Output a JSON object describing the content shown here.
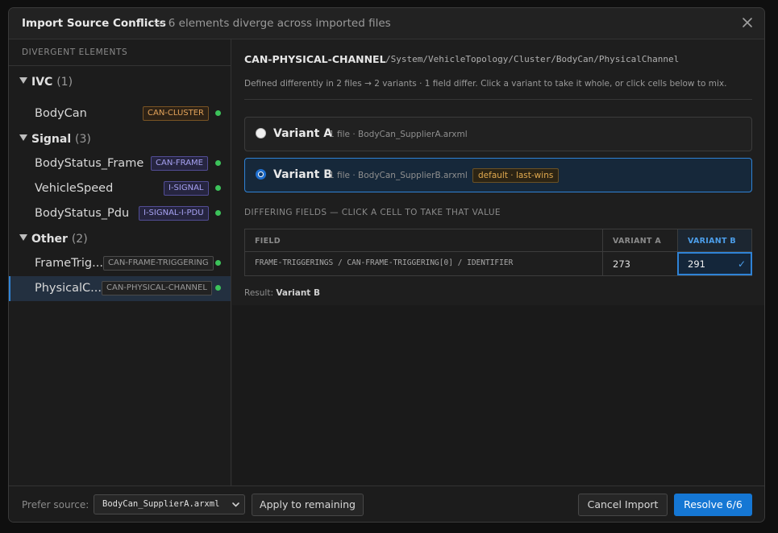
{
  "header": {
    "title": "Import Source Conflicts",
    "subtitle": "— 6 elements diverge across imported files"
  },
  "sidebar": {
    "section_title": "DIVERGENT ELEMENTS",
    "groups": [
      {
        "name": "IVC",
        "count": "(1)"
      },
      {
        "name": "Signal",
        "count": "(3)"
      },
      {
        "name": "Other",
        "count": "(2)"
      }
    ],
    "items": [
      {
        "name": "BodyCan",
        "badge": "CAN-CLUSTER"
      },
      {
        "name": "BodyStatus_Frame",
        "badge": "CAN-FRAME"
      },
      {
        "name": "VehicleSpeed",
        "badge": "I-SIGNAL"
      },
      {
        "name": "BodyStatus_Pdu",
        "badge": "I-SIGNAL-I-PDU"
      },
      {
        "name": "FrameTrig...",
        "badge": "CAN-FRAME-TRIGGERING"
      },
      {
        "name": "PhysicalC...",
        "badge": "CAN-PHYSICAL-CHANNEL"
      }
    ],
    "selected_index": 5
  },
  "main": {
    "title": "CAN-PHYSICAL-CHANNEL",
    "separator": "·",
    "path": "/System/VehicleTopology/Cluster/BodyCan/PhysicalChannel",
    "description": "Defined differently in 2 files → 2 variants · 1 field differ. Click a variant to take it whole, or click cells below to mix.",
    "variants": [
      {
        "name": "Variant A",
        "meta": "1 file · BodyCan_SupplierA.arxml",
        "tag": ""
      },
      {
        "name": "Variant B",
        "meta": "1 file · BodyCan_SupplierB.arxml",
        "tag": "default · last-wins"
      }
    ],
    "selected_variant": 1,
    "fields_title": "DIFFERING FIELDS — CLICK A CELL TO TAKE THAT VALUE",
    "table": {
      "headers": [
        "FIELD",
        "VARIANT A",
        "VARIANT B"
      ],
      "rows": [
        {
          "field": "FRAME-TRIGGERINGS / CAN-FRAME-TRIGGERING[0] / IDENTIFIER",
          "a": "273",
          "b": "291",
          "check": "✓"
        }
      ]
    },
    "result_label": "Result:",
    "result_value": "Variant B"
  },
  "footer": {
    "prefer_label": "Prefer source:",
    "prefer_value": "BodyCan_SupplierA.arxml",
    "apply_label": "Apply to remaining",
    "cancel_label": "Cancel Import",
    "resolve_label": "Resolve 6/6"
  },
  "colors": {
    "accent": "#1577d4",
    "success_dot": "#3cc25a",
    "badge_orange": "#e3a35a",
    "badge_purple": "#a7a2f2"
  }
}
